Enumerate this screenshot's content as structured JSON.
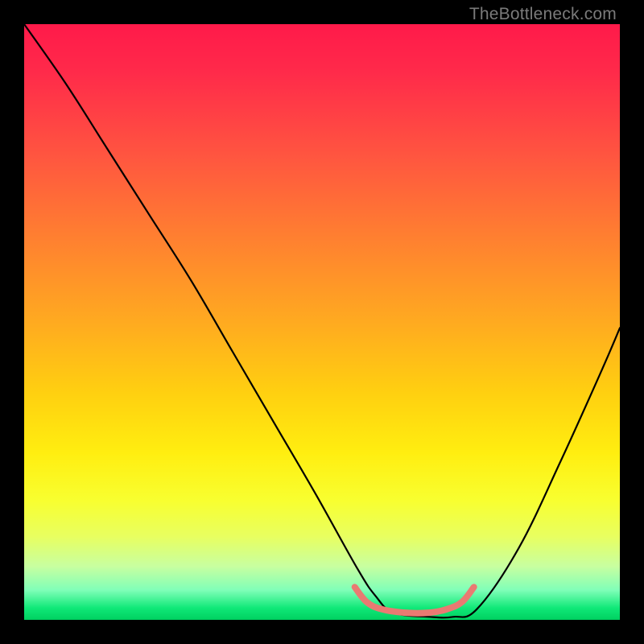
{
  "watermark": "TheBottleneck.com",
  "chart_data": {
    "type": "line",
    "title": "",
    "xlabel": "",
    "ylabel": "",
    "xlim": [
      0,
      1
    ],
    "ylim": [
      0,
      1
    ],
    "background_gradient": {
      "top": "#ff1a4a",
      "mid": "#ffee10",
      "bottom": "#00d060"
    },
    "series": [
      {
        "name": "curve",
        "color": "#000000",
        "x": [
          0.0,
          0.07,
          0.14,
          0.21,
          0.28,
          0.35,
          0.42,
          0.49,
          0.56,
          0.59,
          0.62,
          0.68,
          0.72,
          0.76,
          0.83,
          0.9,
          0.97,
          1.0
        ],
        "values": [
          1.0,
          0.9,
          0.79,
          0.68,
          0.57,
          0.45,
          0.33,
          0.21,
          0.085,
          0.04,
          0.012,
          0.005,
          0.005,
          0.018,
          0.12,
          0.265,
          0.42,
          0.49
        ]
      },
      {
        "name": "bump",
        "color": "#e97a72",
        "x": [
          0.555,
          0.575,
          0.6,
          0.64,
          0.68,
          0.71,
          0.735,
          0.755
        ],
        "values": [
          0.055,
          0.03,
          0.018,
          0.012,
          0.012,
          0.018,
          0.03,
          0.055
        ]
      }
    ]
  }
}
